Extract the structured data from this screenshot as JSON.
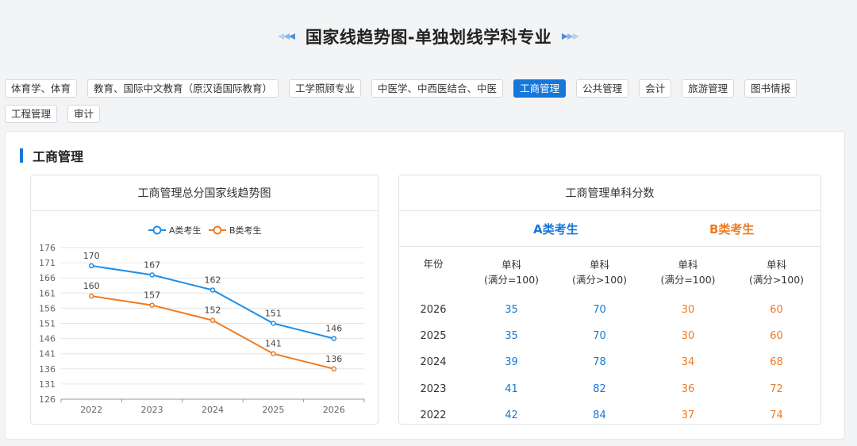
{
  "header": {
    "title": "国家线趋势图-单独划线学科专业"
  },
  "tabs": [
    {
      "label": "体育学、体育",
      "active": false
    },
    {
      "label": "教育、国际中文教育（原汉语国际教育）",
      "active": false
    },
    {
      "label": "工学照顾专业",
      "active": false
    },
    {
      "label": "中医学、中西医结合、中医",
      "active": false
    },
    {
      "label": "工商管理",
      "active": true
    },
    {
      "label": "公共管理",
      "active": false
    },
    {
      "label": "会计",
      "active": false
    },
    {
      "label": "旅游管理",
      "active": false
    },
    {
      "label": "图书情报",
      "active": false
    },
    {
      "label": "工程管理",
      "active": false
    },
    {
      "label": "审计",
      "active": false
    }
  ],
  "section": {
    "title": "工商管理"
  },
  "chart_card": {
    "title": "工商管理总分国家线趋势图"
  },
  "chart_data": {
    "type": "line",
    "title": "工商管理总分国家线趋势图",
    "x": [
      "2022",
      "2023",
      "2024",
      "2025",
      "2026"
    ],
    "series": [
      {
        "name": "A类考生",
        "values": [
          170,
          167,
          162,
          151,
          146
        ],
        "color": "#1f8ee6"
      },
      {
        "name": "B类考生",
        "values": [
          160,
          157,
          152,
          141,
          136
        ],
        "color": "#ef7a22"
      }
    ],
    "yticks": [
      126,
      131,
      136,
      141,
      146,
      151,
      156,
      161,
      166,
      171,
      176
    ],
    "ylim": [
      126,
      176
    ],
    "grid": true,
    "legend": "top-center",
    "xlabel": "",
    "ylabel": ""
  },
  "table_card": {
    "title": "工商管理单科分数",
    "group_a": "A类考生",
    "group_b": "B类考生",
    "headers": {
      "year": "年份",
      "a1": [
        "单科",
        "(满分=100)"
      ],
      "a2": [
        "单科",
        "(满分>100)"
      ],
      "b1": [
        "单科",
        "(满分=100)"
      ],
      "b2": [
        "单科",
        "(满分>100)"
      ]
    },
    "rows": [
      {
        "year": "2026",
        "a1": "35",
        "a2": "70",
        "b1": "30",
        "b2": "60"
      },
      {
        "year": "2025",
        "a1": "35",
        "a2": "70",
        "b1": "30",
        "b2": "60"
      },
      {
        "year": "2024",
        "a1": "39",
        "a2": "78",
        "b1": "34",
        "b2": "68"
      },
      {
        "year": "2023",
        "a1": "41",
        "a2": "82",
        "b1": "36",
        "b2": "72"
      },
      {
        "year": "2022",
        "a1": "42",
        "a2": "84",
        "b1": "37",
        "b2": "74"
      }
    ]
  },
  "colors": {
    "accent": "#1677d9",
    "series_a": "#1f8ee6",
    "series_b": "#ef7a22"
  }
}
